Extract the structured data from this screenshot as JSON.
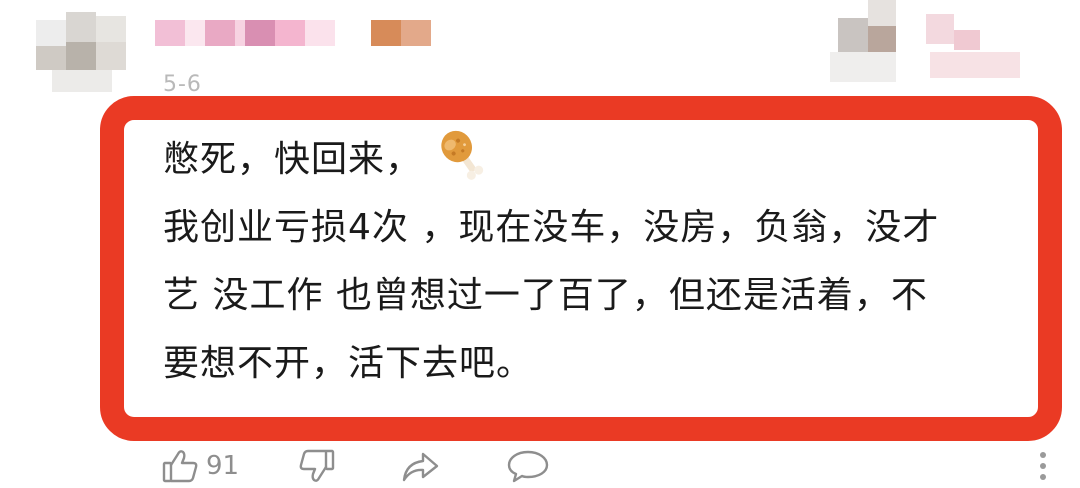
{
  "comment": {
    "date": "5-6",
    "lines": [
      "憋死，快回来，",
      "我创业亏损4次 ，现在没车，没房，负翁，没才",
      "艺 没工作 也曾想过一了百了，但还是活着，不",
      "要想不开，活下去吧。"
    ],
    "emoji": "poultry-leg-icon"
  },
  "actions": {
    "like_count": "91",
    "like_icon": "thumbs-up-icon",
    "dislike_icon": "thumbs-down-icon",
    "share_icon": "share-icon",
    "reply_icon": "comment-bubble-icon",
    "more_icon": "vertical-ellipsis-icon"
  },
  "colors": {
    "highlight_border": "#ea3a24",
    "text": "#1a1a1a",
    "muted": "#8e8e8e",
    "date": "#b9b9b9"
  }
}
